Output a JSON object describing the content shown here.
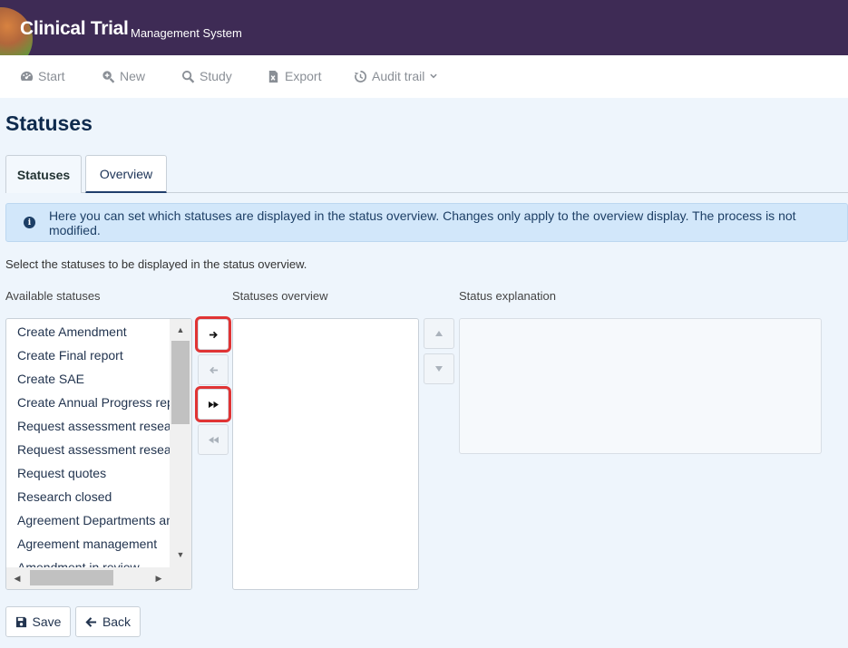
{
  "header": {
    "title": "Clinical Trial",
    "subtitle": "Management System"
  },
  "nav": [
    {
      "label": "Start",
      "icon": "dashboard-icon"
    },
    {
      "label": "New",
      "icon": "search-plus-icon"
    },
    {
      "label": "Study",
      "icon": "search-icon"
    },
    {
      "label": "Export",
      "icon": "file-excel-icon"
    },
    {
      "label": "Audit trail",
      "icon": "history-icon"
    }
  ],
  "page": {
    "title": "Statuses"
  },
  "tabs": [
    {
      "label": "Statuses"
    },
    {
      "label": "Overview"
    }
  ],
  "info": {
    "text": "Here you can set which statuses are displayed in the status overview. Changes only apply to the overview display. The process is not modified."
  },
  "hint": "Select the statuses to be displayed in the status overview.",
  "columns": {
    "available": "Available statuses",
    "overview": "Statuses overview",
    "explanation": "Status explanation"
  },
  "available_items": [
    "Create Amendment",
    "Create Final report",
    "Create SAE",
    "Create Annual Progress report",
    "Request assessment research",
    "Request assessment research",
    "Request quotes",
    "Research closed",
    "Agreement Departments and",
    "Agreement management",
    "Amendment in review"
  ],
  "buttons": {
    "save": "Save",
    "back": "Back"
  }
}
